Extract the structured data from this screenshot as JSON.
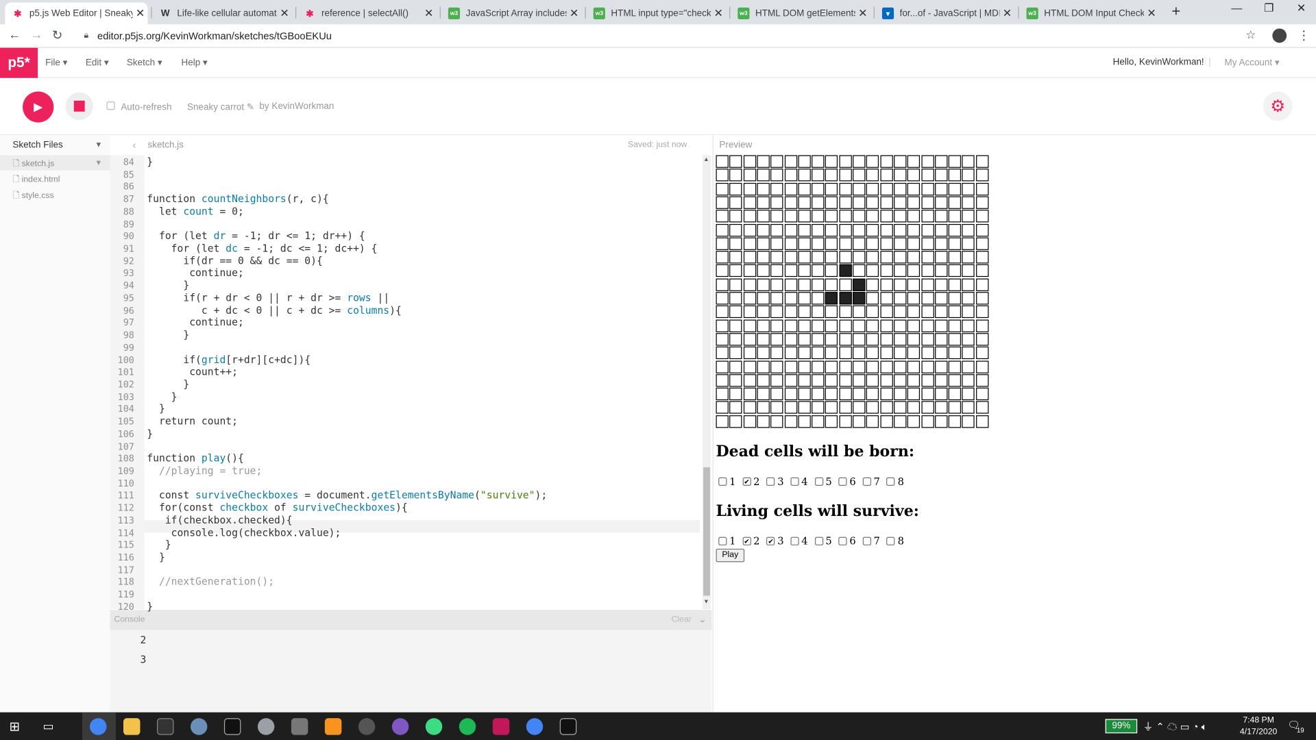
{
  "tabs": [
    {
      "title": "p5.js Web Editor | Sneaky carrot",
      "icon": "p5-asterisk-icon",
      "active": true
    },
    {
      "title": "Life-like cellular automaton - Wikipedia",
      "icon": "wikipedia-icon",
      "active": false
    },
    {
      "title": "reference | selectAll()",
      "icon": "p5-asterisk-icon",
      "active": false
    },
    {
      "title": "JavaScript Array includes() Method",
      "icon": "w3schools-icon",
      "active": false
    },
    {
      "title": "HTML input type=\"checkbox\"",
      "icon": "w3schools-icon",
      "active": false
    },
    {
      "title": "HTML DOM getElementsByName()",
      "icon": "w3schools-icon",
      "active": false
    },
    {
      "title": "for...of - JavaScript | MDN",
      "icon": "mdn-icon",
      "active": false
    },
    {
      "title": "HTML DOM Input Checkbox",
      "icon": "w3schools-icon",
      "active": false
    }
  ],
  "url": "editor.p5js.org/KevinWorkman/sketches/tGBooEKUu",
  "logo": "p5*",
  "menus": [
    "File",
    "Edit",
    "Sketch",
    "Help"
  ],
  "greeting": "Hello, KevinWorkman!",
  "account": "My Account",
  "auto_refresh": "Auto-refresh",
  "sketch_name": "Sneaky carrot",
  "by_line": "by KevinWorkman",
  "sidebar": {
    "header": "Sketch Files",
    "files": [
      "sketch.js",
      "index.html",
      "style.css"
    ]
  },
  "editor": {
    "filename": "sketch.js",
    "saved": "Saved: just now"
  },
  "line_numbers": [
    "84",
    "85",
    "86",
    "87",
    "88",
    "89",
    "90",
    "91",
    "92",
    "93",
    "94",
    "95",
    "96",
    "97",
    "98",
    "99",
    "100",
    "101",
    "102",
    "103",
    "104",
    "105",
    "106",
    "107",
    "108",
    "109",
    "110",
    "111",
    "112",
    "113",
    "114",
    "115",
    "116",
    "117",
    "118",
    "119",
    "120"
  ],
  "code": [
    "}",
    "",
    "",
    "function countNeighbors(r, c){",
    "  let count = 0;",
    "",
    "  for (let dr = -1; dr <= 1; dr++) {",
    "    for (let dc = -1; dc <= 1; dc++) {",
    "      if(dr == 0 && dc == 0){",
    "       continue;",
    "      }",
    "      if(r + dr < 0 || r + dr >= rows ||",
    "         c + dc < 0 || c + dc >= columns){",
    "       continue;",
    "      }",
    "",
    "      if(grid[r+dr][c+dc]){",
    "       count++;",
    "      }",
    "    }",
    "  }",
    "  return count;",
    "}",
    "",
    "function play(){",
    "  //playing = true;",
    "",
    "  const surviveCheckboxes = document.getElementsByName(\"survive\");",
    "  for(const checkbox of surviveCheckboxes){",
    "   if(checkbox.checked){",
    "    console.log(checkbox.value);",
    "   }",
    "  }",
    "",
    "  //nextGeneration();",
    "",
    "}"
  ],
  "console": {
    "title": "Console",
    "clear": "Clear",
    "lines": [
      "2",
      "3"
    ]
  },
  "preview": {
    "label": "Preview",
    "grid_rows": 20,
    "grid_cols": 20,
    "live_cells": [
      [
        8,
        9
      ],
      [
        9,
        10
      ],
      [
        10,
        8
      ],
      [
        10,
        9
      ],
      [
        10,
        10
      ]
    ],
    "born_title": "Dead cells will be born:",
    "born_checked": [
      2
    ],
    "survive_title": "Living cells will survive:",
    "survive_checked": [
      2,
      3
    ],
    "checkbox_labels": [
      "1",
      "2",
      "3",
      "4",
      "5",
      "6",
      "7",
      "8"
    ],
    "play_button": "Play"
  },
  "taskbar": {
    "battery": "99%",
    "time": "7:48 PM",
    "date": "4/17/2020",
    "notifications": "19"
  },
  "colors": {
    "p5_pink": "#ed225d"
  }
}
